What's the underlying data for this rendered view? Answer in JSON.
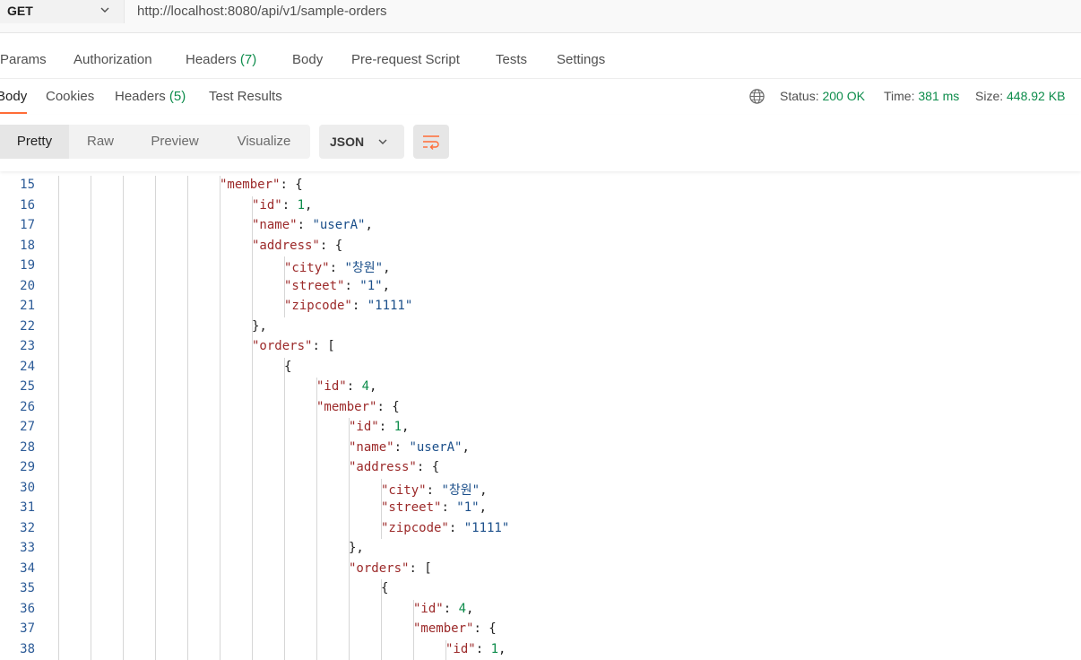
{
  "request": {
    "method": "GET",
    "url": "http://localhost:8080/api/v1/sample-orders",
    "tabs": [
      "Params",
      "Authorization",
      "Headers",
      "Body",
      "Pre-request Script",
      "Tests",
      "Settings"
    ],
    "headers_count": "(7)"
  },
  "response": {
    "tabs": [
      "Body",
      "Cookies",
      "Headers",
      "Test Results"
    ],
    "headers_count": "(5)",
    "status_label": "Status:",
    "status_value": "200 OK",
    "time_label": "Time:",
    "time_value": "381 ms",
    "size_label": "Size:",
    "size_value": "448.92 KB"
  },
  "toolbar": {
    "views": [
      "Pretty",
      "Raw",
      "Preview",
      "Visualize"
    ],
    "active_view": "Pretty",
    "format": "JSON"
  },
  "code_lines": [
    {
      "n": "15",
      "indent": 6,
      "t": [
        [
          "k",
          "\"member\""
        ],
        [
          "p",
          ": {"
        ]
      ]
    },
    {
      "n": "16",
      "indent": 7,
      "t": [
        [
          "k",
          "\"id\""
        ],
        [
          "p",
          ": "
        ],
        [
          "n",
          "1"
        ],
        [
          "p",
          ","
        ]
      ]
    },
    {
      "n": "17",
      "indent": 7,
      "t": [
        [
          "k",
          "\"name\""
        ],
        [
          "p",
          ": "
        ],
        [
          "s",
          "\"userA\""
        ],
        [
          "p",
          ","
        ]
      ]
    },
    {
      "n": "18",
      "indent": 7,
      "t": [
        [
          "k",
          "\"address\""
        ],
        [
          "p",
          ": {"
        ]
      ]
    },
    {
      "n": "19",
      "indent": 8,
      "t": [
        [
          "k",
          "\"city\""
        ],
        [
          "p",
          ": "
        ],
        [
          "s",
          "\"창원\""
        ],
        [
          "p",
          ","
        ]
      ]
    },
    {
      "n": "20",
      "indent": 8,
      "t": [
        [
          "k",
          "\"street\""
        ],
        [
          "p",
          ": "
        ],
        [
          "s",
          "\"1\""
        ],
        [
          "p",
          ","
        ]
      ]
    },
    {
      "n": "21",
      "indent": 8,
      "t": [
        [
          "k",
          "\"zipcode\""
        ],
        [
          "p",
          ": "
        ],
        [
          "s",
          "\"1111\""
        ]
      ]
    },
    {
      "n": "22",
      "indent": 7,
      "t": [
        [
          "p",
          "},"
        ]
      ]
    },
    {
      "n": "23",
      "indent": 7,
      "t": [
        [
          "k",
          "\"orders\""
        ],
        [
          "p",
          ": ["
        ]
      ]
    },
    {
      "n": "24",
      "indent": 8,
      "t": [
        [
          "p",
          "{"
        ]
      ]
    },
    {
      "n": "25",
      "indent": 9,
      "t": [
        [
          "k",
          "\"id\""
        ],
        [
          "p",
          ": "
        ],
        [
          "n",
          "4"
        ],
        [
          "p",
          ","
        ]
      ]
    },
    {
      "n": "26",
      "indent": 9,
      "t": [
        [
          "k",
          "\"member\""
        ],
        [
          "p",
          ": {"
        ]
      ]
    },
    {
      "n": "27",
      "indent": 10,
      "t": [
        [
          "k",
          "\"id\""
        ],
        [
          "p",
          ": "
        ],
        [
          "n",
          "1"
        ],
        [
          "p",
          ","
        ]
      ]
    },
    {
      "n": "28",
      "indent": 10,
      "t": [
        [
          "k",
          "\"name\""
        ],
        [
          "p",
          ": "
        ],
        [
          "s",
          "\"userA\""
        ],
        [
          "p",
          ","
        ]
      ]
    },
    {
      "n": "29",
      "indent": 10,
      "t": [
        [
          "k",
          "\"address\""
        ],
        [
          "p",
          ": {"
        ]
      ]
    },
    {
      "n": "30",
      "indent": 11,
      "t": [
        [
          "k",
          "\"city\""
        ],
        [
          "p",
          ": "
        ],
        [
          "s",
          "\"창원\""
        ],
        [
          "p",
          ","
        ]
      ]
    },
    {
      "n": "31",
      "indent": 11,
      "t": [
        [
          "k",
          "\"street\""
        ],
        [
          "p",
          ": "
        ],
        [
          "s",
          "\"1\""
        ],
        [
          "p",
          ","
        ]
      ]
    },
    {
      "n": "32",
      "indent": 11,
      "t": [
        [
          "k",
          "\"zipcode\""
        ],
        [
          "p",
          ": "
        ],
        [
          "s",
          "\"1111\""
        ]
      ]
    },
    {
      "n": "33",
      "indent": 10,
      "t": [
        [
          "p",
          "},"
        ]
      ]
    },
    {
      "n": "34",
      "indent": 10,
      "t": [
        [
          "k",
          "\"orders\""
        ],
        [
          "p",
          ": ["
        ]
      ]
    },
    {
      "n": "35",
      "indent": 11,
      "t": [
        [
          "p",
          "{"
        ]
      ]
    },
    {
      "n": "36",
      "indent": 12,
      "t": [
        [
          "k",
          "\"id\""
        ],
        [
          "p",
          ": "
        ],
        [
          "n",
          "4"
        ],
        [
          "p",
          ","
        ]
      ]
    },
    {
      "n": "37",
      "indent": 12,
      "t": [
        [
          "k",
          "\"member\""
        ],
        [
          "p",
          ": {"
        ]
      ]
    },
    {
      "n": "38",
      "indent": 13,
      "t": [
        [
          "k",
          "\"id\""
        ],
        [
          "p",
          ": "
        ],
        [
          "n",
          "1"
        ],
        [
          "p",
          ","
        ]
      ]
    }
  ],
  "icons": {
    "method_dropdown": "chevron-down-icon",
    "network": "globe-icon",
    "format_dropdown": "chevron-down-icon",
    "wrap": "wrap-lines-icon"
  },
  "colors": {
    "accent": "#ff6c37",
    "success": "#0d8c4b",
    "json_key": "#9c2a2a",
    "json_string": "#1b4f8a"
  }
}
